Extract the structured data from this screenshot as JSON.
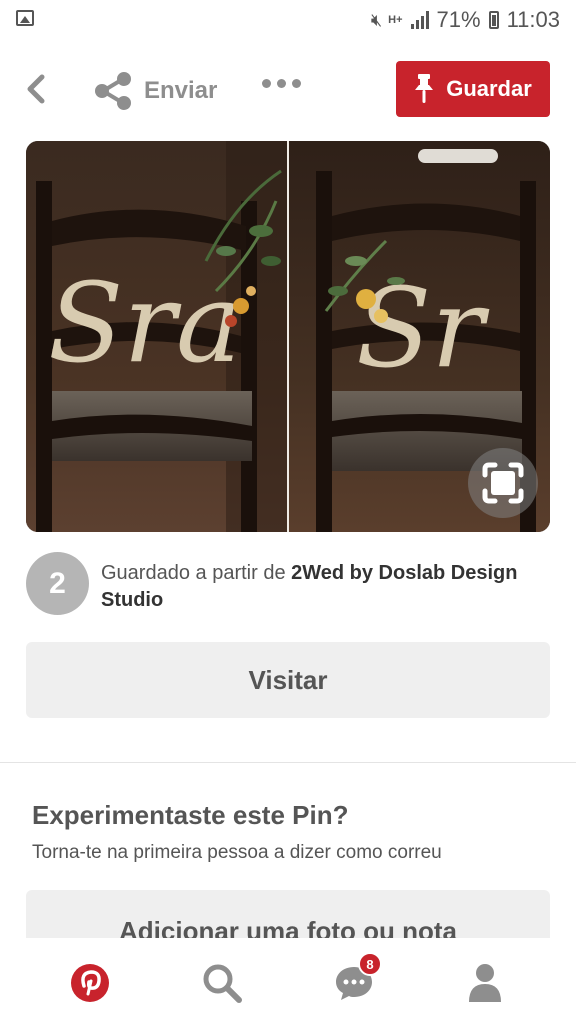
{
  "status_bar": {
    "battery": "71%",
    "time": "11:03",
    "network": "H+"
  },
  "action_bar": {
    "share_label": "Enviar",
    "save_label": "Guardar"
  },
  "pin": {
    "left_sign": "Sra",
    "right_sign": "Sr"
  },
  "attribution": {
    "avatar_initial": "2",
    "prefix": "Guardado a partir de ",
    "source": "2Wed by Doslab Design Studio"
  },
  "visit_label": "Visitar",
  "tried": {
    "title": "Experimentaste este Pin?",
    "subtitle": "Torna-te na primeira pessoa a dizer como correu",
    "add_photo_label": "Adicionar uma foto ou nota"
  },
  "nav": {
    "messages_badge": "8"
  },
  "colors": {
    "brand_red": "#c8232c",
    "button_gray": "#efefef",
    "text_gray": "#555555"
  }
}
